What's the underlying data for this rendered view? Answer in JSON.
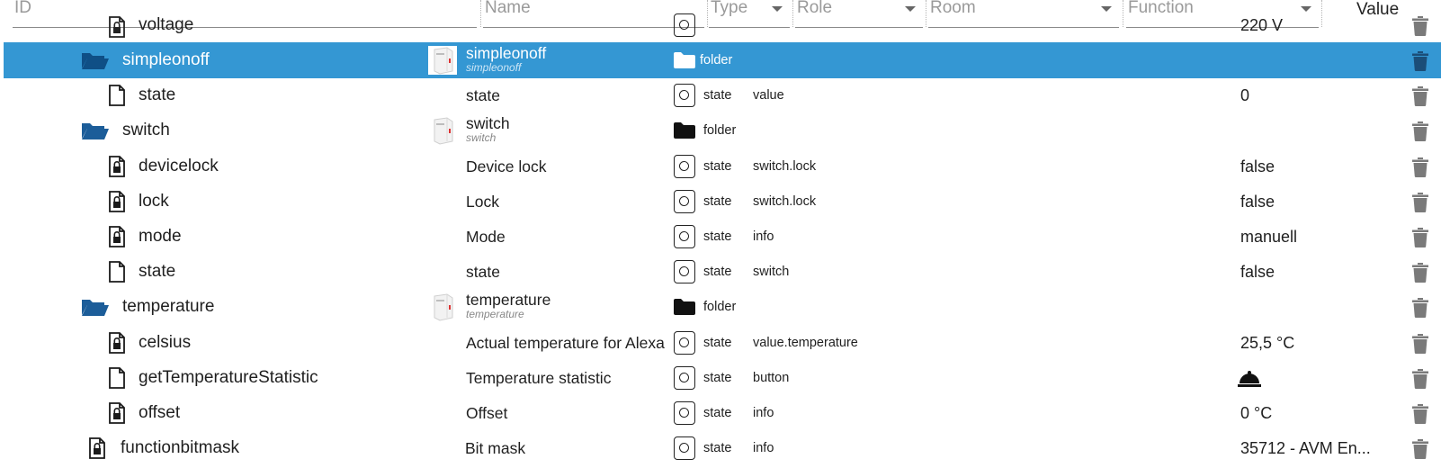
{
  "filters": {
    "id_placeholder": "ID",
    "name_placeholder": "Name",
    "type_label": "Type",
    "role_label": "Role",
    "room_label": "Room",
    "function_label": "Function",
    "value_label": "Value"
  },
  "partial_row": {
    "id": "voltage",
    "value": "220 V"
  },
  "rows": [
    {
      "id": "simpleonoff",
      "kind": "folder",
      "name": "simpleonoff",
      "name_sub": "simpleonoff",
      "type": "folder",
      "role": "",
      "value": "",
      "selected": true
    },
    {
      "id": "state",
      "kind": "file",
      "name": "state",
      "type": "state",
      "role": "value",
      "value": "0"
    },
    {
      "id": "switch",
      "kind": "folder",
      "name": "switch",
      "name_sub": "switch",
      "type": "folder",
      "role": "",
      "value": ""
    },
    {
      "id": "devicelock",
      "kind": "lock",
      "name": "Device lock",
      "type": "state",
      "role": "switch.lock",
      "value": "false"
    },
    {
      "id": "lock",
      "kind": "lock",
      "name": "Lock",
      "type": "state",
      "role": "switch.lock",
      "value": "false"
    },
    {
      "id": "mode",
      "kind": "lock",
      "name": "Mode",
      "type": "state",
      "role": "info",
      "value": "manuell"
    },
    {
      "id": "state",
      "kind": "file",
      "name": "state",
      "type": "state",
      "role": "switch",
      "value": "false"
    },
    {
      "id": "temperature",
      "kind": "folder",
      "name": "temperature",
      "name_sub": "temperature",
      "type": "folder",
      "role": "",
      "value": ""
    },
    {
      "id": "celsius",
      "kind": "lock",
      "name": "Actual temperature for Alexa",
      "type": "state",
      "role": "value.temperature",
      "value": "25,5 °C"
    },
    {
      "id": "getTemperatureStatistic",
      "kind": "file",
      "name": "Temperature statistic",
      "type": "state",
      "role": "button",
      "value": "",
      "value_icon": "bell-icon"
    },
    {
      "id": "offset",
      "kind": "lock",
      "name": "Offset",
      "type": "state",
      "role": "info",
      "value": "0 °C"
    },
    {
      "id": "functionbitmask",
      "kind": "lock",
      "name": "Bit mask",
      "type": "state",
      "role": "info",
      "value": "35712 - AVM En..."
    }
  ],
  "colors": {
    "selected_row": "#3497d3",
    "folder_icon": "#1c5d99",
    "trash": "#7a7a7a"
  }
}
